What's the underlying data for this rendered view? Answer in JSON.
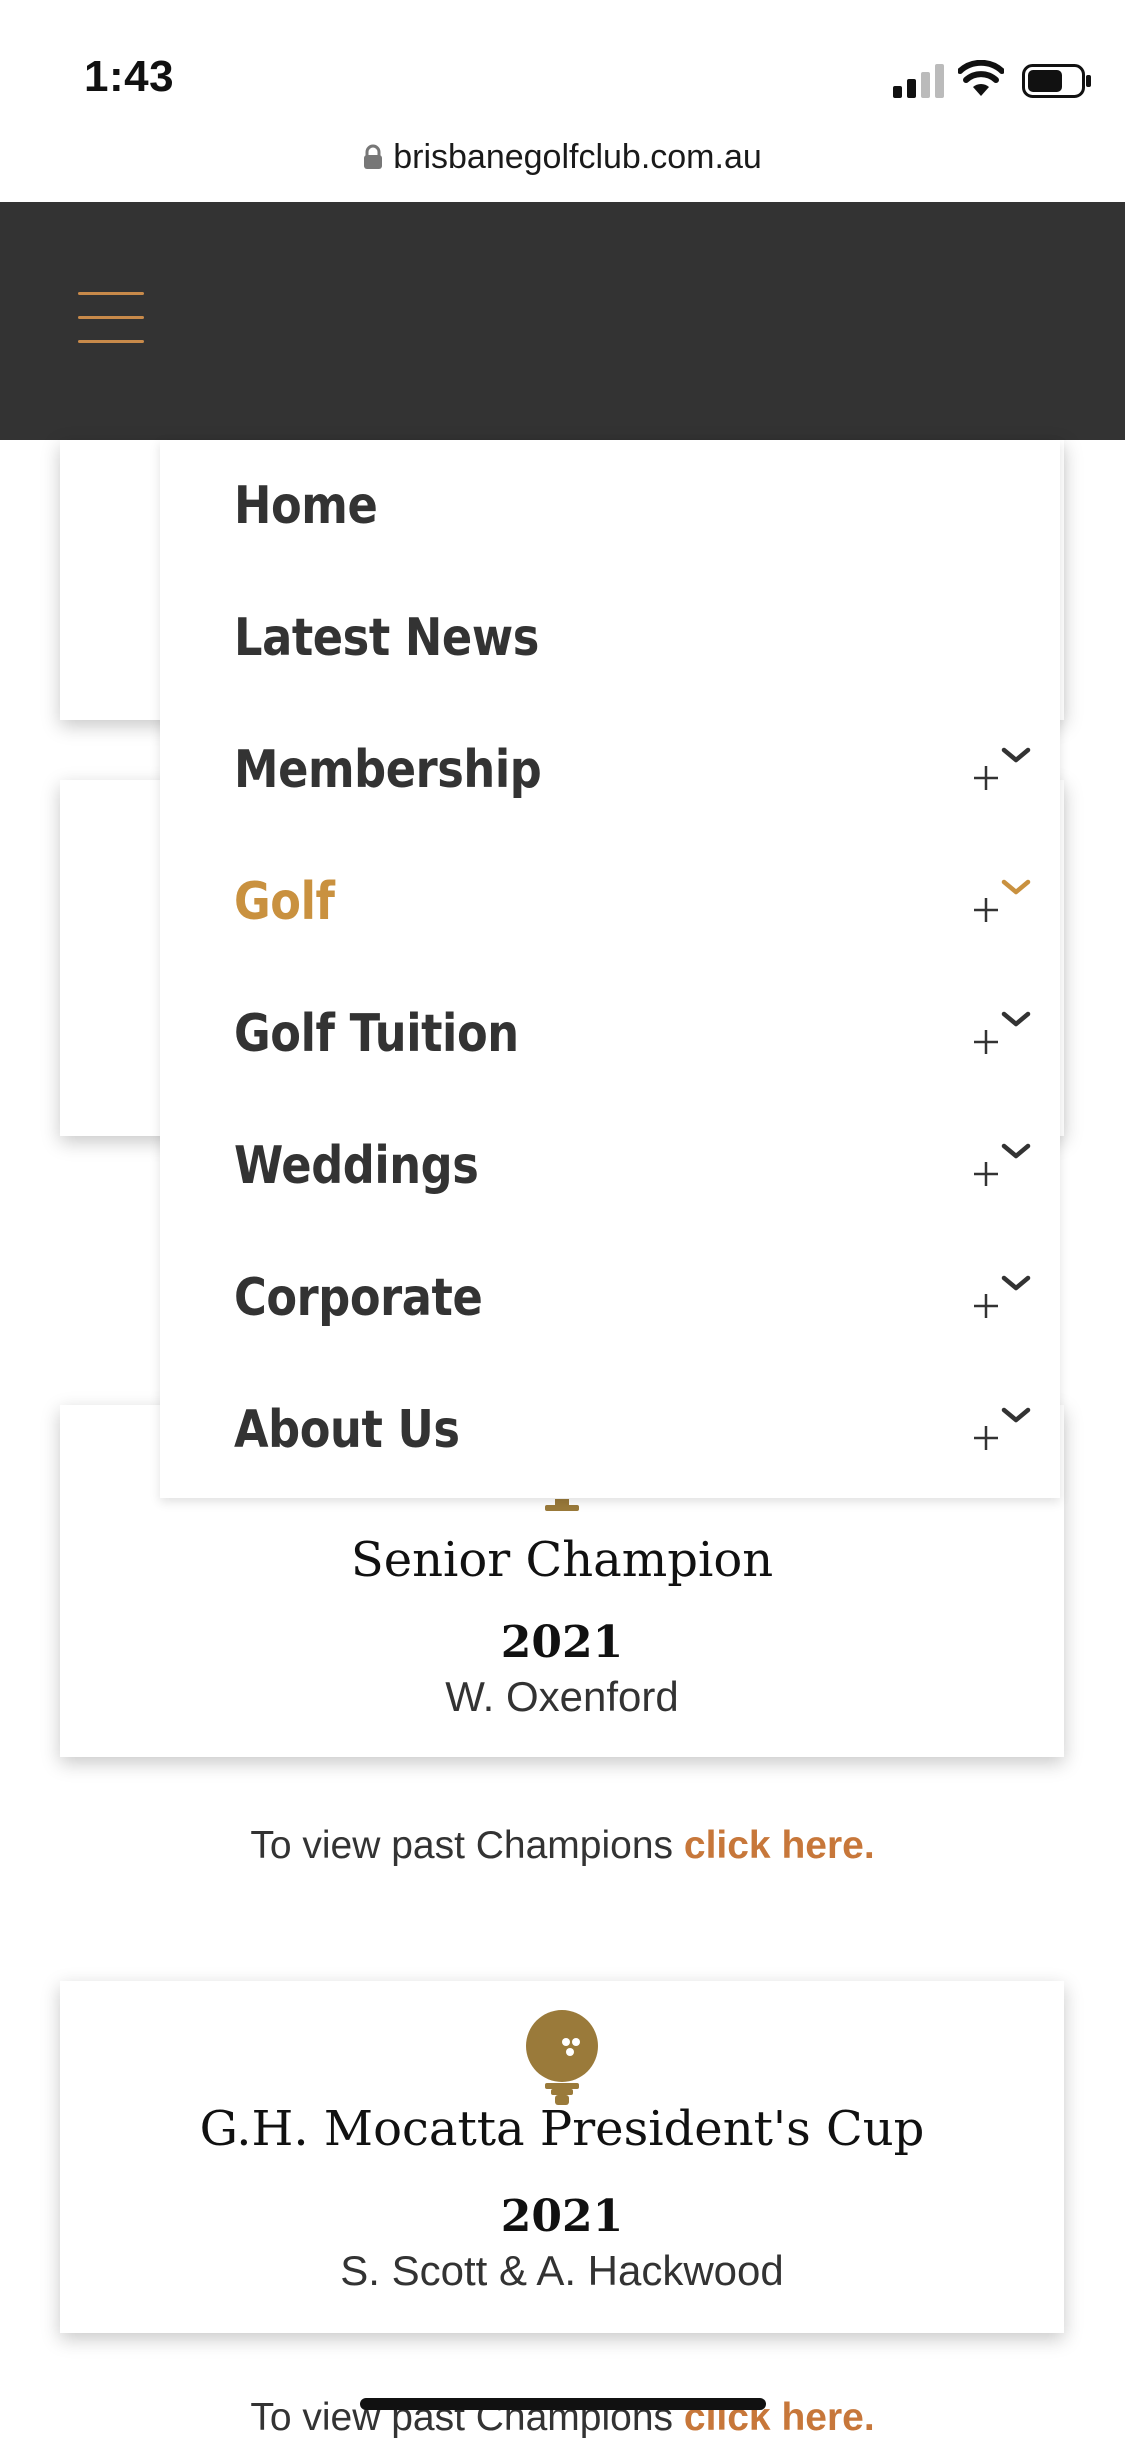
{
  "status_bar": {
    "time": "1:43"
  },
  "browser": {
    "url": "brisbanegolfclub.com.au"
  },
  "nav": {
    "items": [
      {
        "label": "Home",
        "expandable": false,
        "active": false
      },
      {
        "label": "Latest News",
        "expandable": false,
        "active": false
      },
      {
        "label": "Membership",
        "expandable": true,
        "active": false
      },
      {
        "label": "Golf",
        "expandable": true,
        "active": true
      },
      {
        "label": "Golf Tuition",
        "expandable": true,
        "active": false
      },
      {
        "label": "Weddings",
        "expandable": true,
        "active": false
      },
      {
        "label": "Corporate",
        "expandable": true,
        "active": false
      },
      {
        "label": "About Us",
        "expandable": true,
        "active": false
      }
    ]
  },
  "cards": [
    {
      "title": "Senior Champion",
      "year": "2021",
      "winner": "W. Oxenford"
    },
    {
      "title": "G.H. Mocatta President's Cup",
      "year": "2021",
      "winner": "S. Scott & A. Hackwood"
    }
  ],
  "past_champions": {
    "text": "To view past Champions ",
    "link": "click here."
  },
  "colors": {
    "header_bg": "#333333",
    "accent": "#c88a4a",
    "active_nav": "#c9913f",
    "link": "#c7773a",
    "trophy": "#9a7a3a"
  }
}
